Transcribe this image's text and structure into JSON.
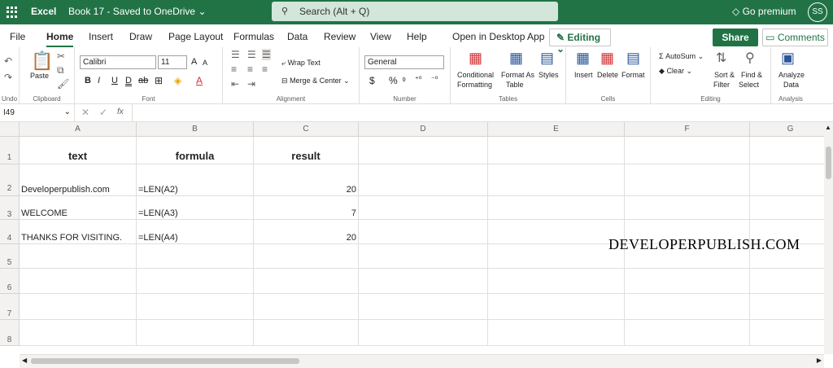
{
  "titlebar": {
    "app": "Excel",
    "book": "Book 17  -  Saved to OneDrive",
    "search_placeholder": "Search (Alt + Q)",
    "premium": "Go premium",
    "avatar": "SS"
  },
  "tabs": [
    "File",
    "Home",
    "Insert",
    "Draw",
    "Page Layout",
    "Formulas",
    "Data",
    "Review",
    "View",
    "Help",
    "Open in Desktop App"
  ],
  "editing": "Editing",
  "share": "Share",
  "comments": "Comments",
  "ribbon": {
    "undo": "Undo",
    "clipboard": "Clipboard",
    "paste": "Paste",
    "font_name": "Calibri",
    "font_size": "11",
    "font": "Font",
    "wrap": "Wrap Text",
    "merge": "Merge & Center",
    "alignment": "Alignment",
    "number_format": "General",
    "number": "Number",
    "cond1": "Conditional",
    "cond2": "Formatting",
    "fat1": "Format As",
    "fat2": "Table",
    "styles": "Styles",
    "tables": "Tables",
    "insert": "Insert",
    "delete": "Delete",
    "format": "Format",
    "cells": "Cells",
    "autosum": "AutoSum",
    "clear": "Clear",
    "sort1": "Sort &",
    "sort2": "Filter",
    "find1": "Find &",
    "find2": "Select",
    "editing": "Editing",
    "analyze1": "Analyze",
    "analyze2": "Data",
    "analysis": "Analysis"
  },
  "formula_bar": {
    "cell_ref": "I49",
    "fx": "fx",
    "value": ""
  },
  "columns": [
    "A",
    "B",
    "C",
    "D",
    "E",
    "F",
    "G"
  ],
  "rows": [
    "1",
    "2",
    "3",
    "4",
    "5",
    "6",
    "7",
    "8"
  ],
  "table": {
    "headers": [
      "text",
      "formula",
      "result"
    ],
    "data": [
      [
        "Developerpublish.com",
        "=LEN(A2)",
        "20"
      ],
      [
        "WELCOME",
        "=LEN(A3)",
        "7"
      ],
      [
        "THANKS FOR VISITING.",
        "=LEN(A4)",
        "20"
      ]
    ]
  },
  "watermark": "DEVELOPERPUBLISH.COM"
}
